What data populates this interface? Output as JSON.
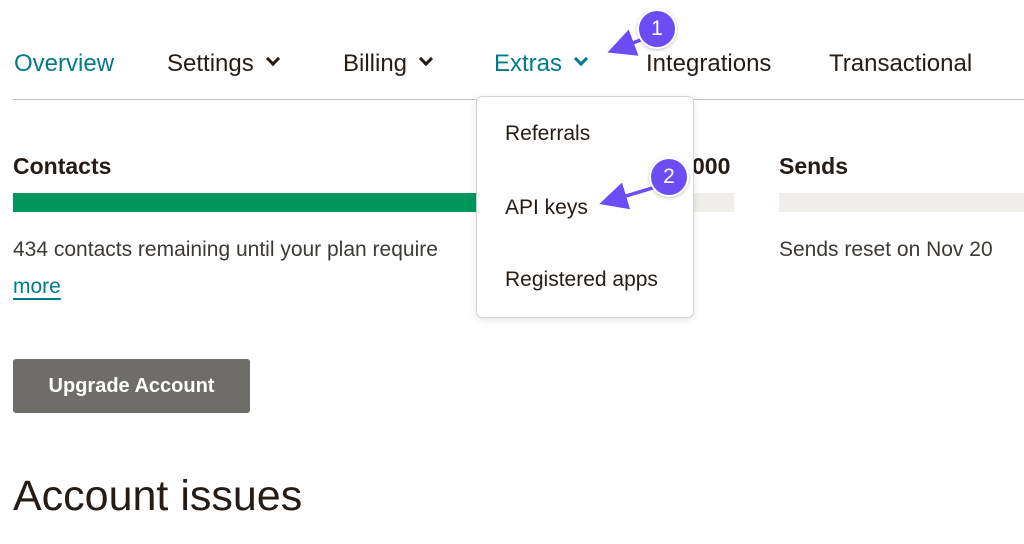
{
  "nav": {
    "items": [
      {
        "label": "Overview",
        "active": true,
        "has_menu": false
      },
      {
        "label": "Settings",
        "active": false,
        "has_menu": true
      },
      {
        "label": "Billing",
        "active": false,
        "has_menu": true
      },
      {
        "label": "Extras",
        "active": true,
        "has_menu": true
      },
      {
        "label": "Integrations",
        "active": false,
        "has_menu": false
      },
      {
        "label": "Transactional",
        "active": false,
        "has_menu": false
      }
    ]
  },
  "extras_menu": {
    "items": [
      {
        "label": "Referrals"
      },
      {
        "label": "API keys"
      },
      {
        "label": "Registered apps"
      }
    ]
  },
  "contacts": {
    "label": "Contacts",
    "limit_fragment": "000",
    "progress_fraction": 0.85,
    "remaining_text": "434 contacts remaining until your plan require",
    "learn_more_label": "more"
  },
  "sends": {
    "label": "Sends",
    "progress_fraction": 0,
    "reset_text": "Sends reset on Nov 20"
  },
  "upgrade_button": {
    "label": "Upgrade Account"
  },
  "account_issues": {
    "heading": "Account issues"
  },
  "annotations": [
    {
      "number": "1",
      "target": "Extras"
    },
    {
      "number": "2",
      "target": "API keys"
    }
  ],
  "colors": {
    "accent_teal": "#007c89",
    "progress_green": "#00965e",
    "button_gray": "#6f6d69",
    "annotation_purple": "#6c4cf5"
  }
}
